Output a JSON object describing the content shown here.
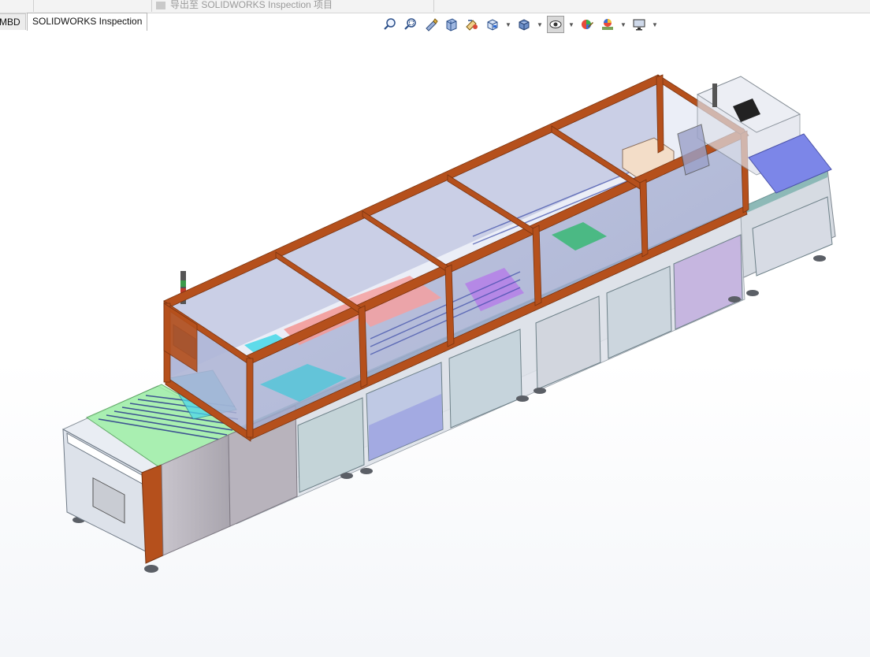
{
  "window": {
    "title_strip_text": "导出至 SOLIDWORKS Inspection 项目"
  },
  "tabs": [
    {
      "label": "MBD"
    },
    {
      "label": "SOLIDWORKS Inspection"
    }
  ],
  "heads_up_toolbar": {
    "icons": [
      "zoom-to-fit-icon",
      "zoom-to-area-icon",
      "previous-view-icon",
      "section-view-icon",
      "dynamic-annotation-views-icon",
      "view-orientation-icon",
      "display-style-icon",
      "hide-show-items-icon",
      "edit-appearance-icon",
      "apply-scene-icon",
      "view-settings-icon"
    ]
  },
  "colors": {
    "frame": "#b5501c",
    "frame_dark": "#7a3410",
    "glass": "#9aa4c8",
    "guard_green": "#9ff0a6",
    "cyan": "#4fd8e8",
    "pink": "#f39a98",
    "violet": "#b57fe8",
    "screen_blue": "#2f86e6",
    "panel_gray": "#b9b6bd",
    "hood_blue": "#7c86e8"
  }
}
